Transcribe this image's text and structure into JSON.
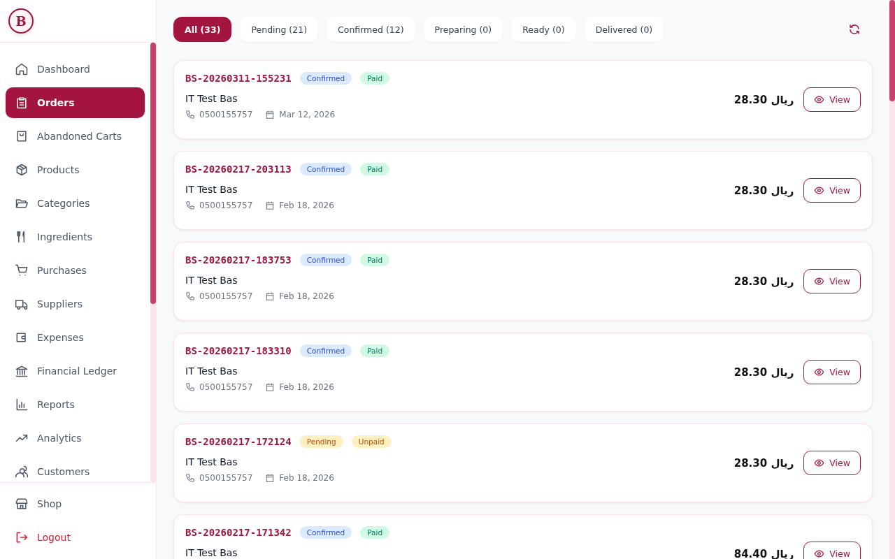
{
  "logo": {
    "letter": "B"
  },
  "sidebar": {
    "items": [
      {
        "label": "Dashboard",
        "selected": false
      },
      {
        "label": "Orders",
        "selected": true
      },
      {
        "label": "Abandoned Carts",
        "selected": false
      },
      {
        "label": "Products",
        "selected": false
      },
      {
        "label": "Categories",
        "selected": false
      },
      {
        "label": "Ingredients",
        "selected": false
      },
      {
        "label": "Purchases",
        "selected": false
      },
      {
        "label": "Suppliers",
        "selected": false
      },
      {
        "label": "Expenses",
        "selected": false
      },
      {
        "label": "Financial Ledger",
        "selected": false
      },
      {
        "label": "Reports",
        "selected": false
      },
      {
        "label": "Analytics",
        "selected": false
      },
      {
        "label": "Customers",
        "selected": false
      }
    ],
    "footer": [
      {
        "label": "Shop",
        "kind": "normal"
      },
      {
        "label": "Logout",
        "kind": "danger"
      }
    ]
  },
  "tabs": [
    {
      "label": "All (33)",
      "selected": true
    },
    {
      "label": "Pending (21)",
      "selected": false
    },
    {
      "label": "Confirmed (12)",
      "selected": false
    },
    {
      "label": "Preparing (0)",
      "selected": false
    },
    {
      "label": "Ready (0)",
      "selected": false
    },
    {
      "label": "Delivered (0)",
      "selected": false
    }
  ],
  "orders": [
    {
      "number": "BS-20260311-155231",
      "badges": [
        {
          "label": "Confirmed",
          "kind": "confirmed"
        },
        {
          "label": "Paid",
          "kind": "paid"
        }
      ],
      "customer": "IT Test Bas",
      "phone": "0500155757",
      "date": "Mar 12, 2026",
      "total": "28.30 ريال",
      "action": "View"
    },
    {
      "number": "BS-20260217-203113",
      "badges": [
        {
          "label": "Confirmed",
          "kind": "confirmed"
        },
        {
          "label": "Paid",
          "kind": "paid"
        }
      ],
      "customer": "IT Test Bas",
      "phone": "0500155757",
      "date": "Feb 18, 2026",
      "total": "28.30 ريال",
      "action": "View"
    },
    {
      "number": "BS-20260217-183753",
      "badges": [
        {
          "label": "Confirmed",
          "kind": "confirmed"
        },
        {
          "label": "Paid",
          "kind": "paid"
        }
      ],
      "customer": "IT Test Bas",
      "phone": "0500155757",
      "date": "Feb 18, 2026",
      "total": "28.30 ريال",
      "action": "View"
    },
    {
      "number": "BS-20260217-183310",
      "badges": [
        {
          "label": "Confirmed",
          "kind": "confirmed"
        },
        {
          "label": "Paid",
          "kind": "paid"
        }
      ],
      "customer": "IT Test Bas",
      "phone": "0500155757",
      "date": "Feb 18, 2026",
      "total": "28.30 ريال",
      "action": "View"
    },
    {
      "number": "BS-20260217-172124",
      "badges": [
        {
          "label": "Pending",
          "kind": "pending"
        },
        {
          "label": "Unpaid",
          "kind": "unpaid"
        }
      ],
      "customer": "IT Test Bas",
      "phone": "0500155757",
      "date": "Feb 18, 2026",
      "total": "28.30 ريال",
      "action": "View"
    },
    {
      "number": "BS-20260217-171342",
      "badges": [
        {
          "label": "Confirmed",
          "kind": "confirmed"
        },
        {
          "label": "Paid",
          "kind": "paid"
        }
      ],
      "customer": "IT Test Bas",
      "total": "84.40 ريال",
      "action": "View"
    }
  ]
}
